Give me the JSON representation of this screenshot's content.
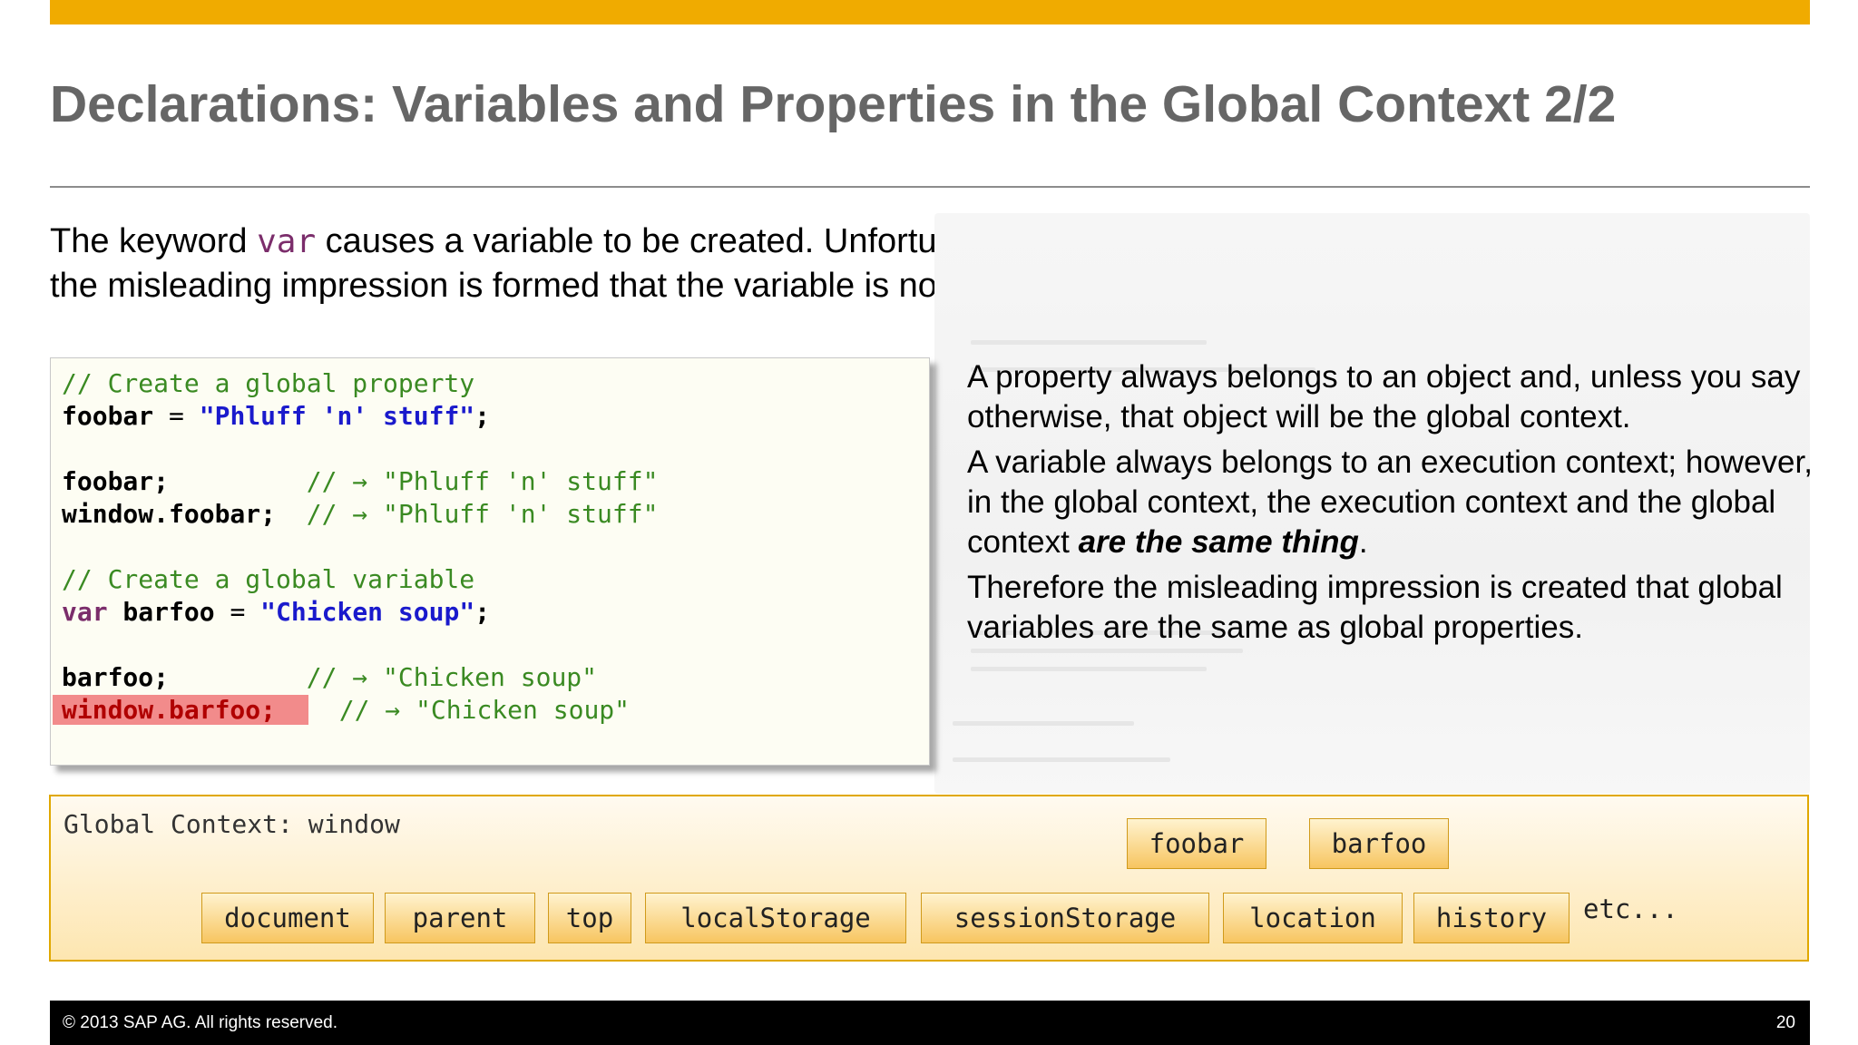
{
  "slide": {
    "title": "Declarations: Variables and Properties in the Global Context 2/2",
    "intro_before": "The keyword ",
    "intro_keyword": "var",
    "intro_after": " causes a variable to be created.  Unfortunately, when a variable is declared in the Global Context, the misleading impression is formed that the variable is no different from any other property of the window object."
  },
  "code": {
    "c1": "// Create a global property",
    "l2_name": "foobar",
    "l2_eq": " = ",
    "l2_str": "\"Phluff 'n' stuff\"",
    "l2_end": ";",
    "l4_name": "foobar;",
    "l4_pad": "         ",
    "l4_cmt": "// → \"Phluff 'n' stuff\"",
    "l5_name": "window.foobar;",
    "l5_pad": "  ",
    "l5_cmt": "// → \"Phluff 'n' stuff\"",
    "c7": "// Create a global variable",
    "l8_kw": "var",
    "l8_name": " barfoo",
    "l8_eq": " = ",
    "l8_str": "\"Chicken soup\"",
    "l8_end": ";",
    "l10_name": "barfoo;",
    "l10_pad": "         ",
    "l10_cmt": "// → \"Chicken soup\"",
    "l11_name": "window.barfoo;",
    "l11_pad": "  ",
    "l11_cmt": "// → \"Chicken soup\""
  },
  "side": {
    "p1": "A property always belongs to an object and, unless you say otherwise, that object will be the global context.",
    "p2_before": "A variable always belongs to an execution context; however, in the global context, the execution context and the global context ",
    "p2_emph": "are the same thing",
    "p2_after": ".",
    "p3": "Therefore the misleading impression is created that global variables are the same as global properties."
  },
  "global_context": {
    "label": "Global Context: window",
    "chips_top": [
      "foobar",
      "barfoo"
    ],
    "chips_bottom": [
      "document",
      "parent",
      "top",
      "localStorage",
      "sessionStorage",
      "location",
      "history"
    ],
    "etc": "etc..."
  },
  "footer": {
    "copyright": "©  2013 SAP AG. All rights reserved.",
    "page": "20"
  },
  "colors": {
    "accent": "#f0ab00",
    "title_gray": "#666666",
    "comment_green": "#3a8a22",
    "string_blue": "#1a1acc",
    "highlight_red": "#f28b8b"
  }
}
